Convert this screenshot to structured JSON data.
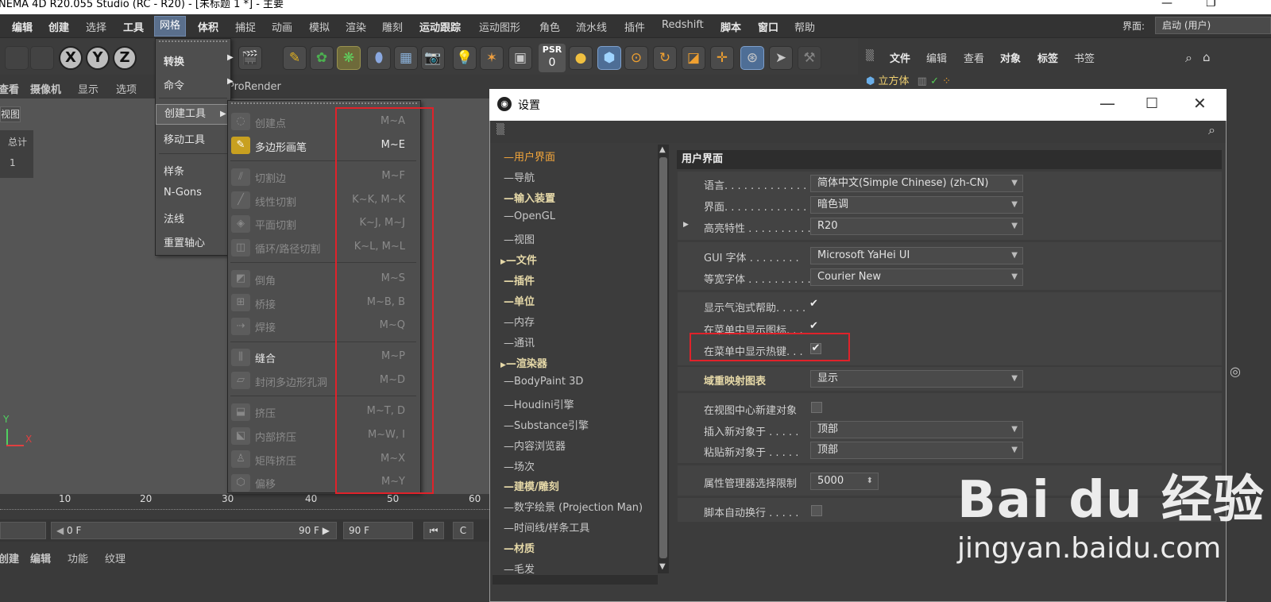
{
  "titlebar": {
    "title": "NEMA 4D R20.055 Studio (RC - R20) - [未标题 1 *] - 主要",
    "minimize": "—",
    "restore": "❐"
  },
  "menubar": {
    "items": [
      "编辑",
      "创建",
      "选择",
      "工具",
      "网格",
      "体积",
      "捕捉",
      "动画",
      "模拟",
      "渲染",
      "雕刻",
      "运动跟踪",
      "运动图形",
      "角色",
      "流水线",
      "插件",
      "Redshift",
      "脚本",
      "窗口",
      "帮助"
    ],
    "layout_label": "界面:",
    "layout_value": "启动 (用户)"
  },
  "toolbar": {
    "axis_x": "X",
    "axis_y": "Y",
    "axis_z": "Z",
    "psr_label": "PSR",
    "psr_value": "0"
  },
  "object_manager": {
    "menu": [
      "文件",
      "编辑",
      "查看",
      "对象",
      "标签",
      "书签"
    ],
    "object_name": "立方体"
  },
  "viewport": {
    "menu": [
      "查看",
      "摄像机",
      "显示",
      "选项"
    ],
    "prorender": "ProRender",
    "tag": "视图",
    "stat_label": "总计",
    "stat_value": "1",
    "axis_y": "Y",
    "axis_x": "X"
  },
  "timeline": {
    "ticks": [
      "10",
      "20",
      "30",
      "40",
      "50",
      "60"
    ],
    "start_frame": "0 F",
    "end_frame": "90 F",
    "end_frame2": "90 F"
  },
  "material_bar": {
    "items": [
      "创建",
      "编辑",
      "功能",
      "纹理"
    ]
  },
  "mesh_menu": {
    "items": [
      {
        "label": "转换",
        "arrow": "▶"
      },
      {
        "label": "命令",
        "arrow": "▶"
      },
      {
        "label": "创建工具",
        "arrow": "▶"
      },
      {
        "label": "移动工具",
        "arrow": "▶"
      },
      {
        "label": "样条",
        "arrow": "▶"
      },
      {
        "label": "N-Gons",
        "arrow": "▶"
      },
      {
        "label": "法线",
        "arrow": "▶"
      },
      {
        "label": "重置轴心",
        "arrow": "▶"
      }
    ]
  },
  "tool_menu": {
    "items": [
      {
        "label": "创建点",
        "key": "M~A"
      },
      {
        "label": "多边形画笔",
        "key": "M~E"
      },
      {
        "label": "切割边",
        "key": "M~F"
      },
      {
        "label": "线性切割",
        "key": "K~K, M~K"
      },
      {
        "label": "平面切割",
        "key": "K~J, M~J"
      },
      {
        "label": "循环/路径切割",
        "key": "K~L, M~L"
      },
      {
        "label": "倒角",
        "key": "M~S"
      },
      {
        "label": "桥接",
        "key": "M~B, B"
      },
      {
        "label": "焊接",
        "key": "M~Q"
      },
      {
        "label": "缝合",
        "key": "M~P"
      },
      {
        "label": "封闭多边形孔洞",
        "key": "M~D"
      },
      {
        "label": "挤压",
        "key": "M~T, D"
      },
      {
        "label": "内部挤压",
        "key": "M~W, I"
      },
      {
        "label": "矩阵挤压",
        "key": "M~X"
      },
      {
        "label": "偏移",
        "key": "M~Y"
      }
    ]
  },
  "settings": {
    "title": "设置",
    "tree": [
      "用户界面",
      "导航",
      "输入装置",
      "OpenGL",
      "视图",
      "文件",
      "插件",
      "单位",
      "内存",
      "通讯",
      "渲染器",
      "BodyPaint 3D",
      "Houdini引擎",
      "Substance引擎",
      "内容浏览器",
      "场次",
      "建模/雕刻",
      "数字绘景 (Projection Man)",
      "时间线/样条工具",
      "材质",
      "毛发"
    ],
    "panel_title": "用户界面",
    "language_label": "语言. . . . . . . . . . . . . .",
    "language_value": "简体中文(Simple Chinese) (zh-CN)",
    "scheme_label": "界面. . . . . . . . . . . . . .",
    "scheme_value": "暗色调",
    "highlight_label": "高亮特性 . . . . . . . . . .",
    "highlight_value": "R20",
    "gui_font_label": "GUI 字体 . . . . . . . .",
    "gui_font_value": "Microsoft YaHei UI",
    "mono_font_label": "等宽字体 . . . . . . . . . .",
    "mono_font_value": "Courier New",
    "tooltip_label": "显示气泡式帮助. . . . .",
    "menu_icons_label": "在菜单中显示图标. . .",
    "menu_hotkeys_label": "在菜单中显示热键. . .",
    "color_chart_label": "域重映射图表",
    "color_chart_value": "显示",
    "new_center_label": "在视图中心新建对象",
    "insert_label": "插入新对象于 . . . . .",
    "insert_value": "顶部",
    "paste_label": "粘贴新对象于 . . . . .",
    "paste_value": "顶部",
    "attr_limit_label": "属性管理器选择限制",
    "attr_limit_value": "5000",
    "script_wrap_label": "脚本自动换行 . . . . .",
    "check": "✔"
  },
  "watermark": {
    "brand": "Bai du 经验",
    "url": "jingyan.baidu.com"
  }
}
